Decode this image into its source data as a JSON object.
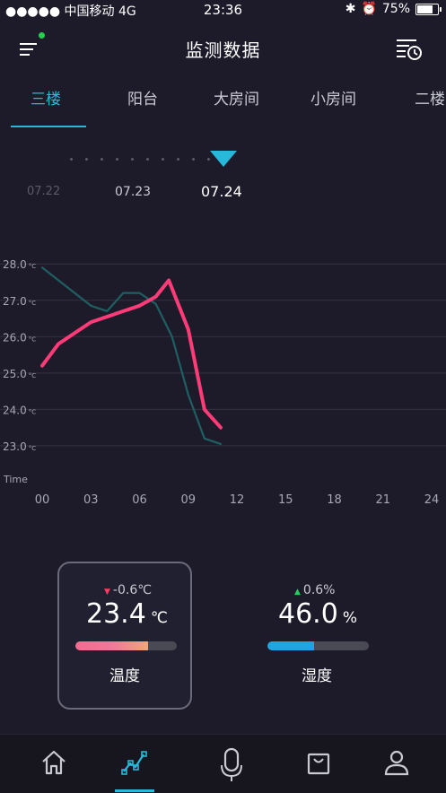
{
  "status_bar": {
    "carrier": "●●●●● 中国移动 4G",
    "time": "23:36",
    "battery": "75%"
  },
  "header": {
    "title": "监测数据"
  },
  "tabs": [
    "三楼",
    "阳台",
    "大房间",
    "小房间",
    "二楼"
  ],
  "dates": [
    "07.22",
    "07.23",
    "07.24"
  ],
  "chart_data": {
    "type": "line",
    "x": [
      0,
      3,
      6,
      9,
      12,
      15,
      18,
      21,
      24
    ],
    "x_tick_labels": [
      "00",
      "03",
      "06",
      "09",
      "12",
      "15",
      "18",
      "21",
      "24"
    ],
    "xlabel": "Time",
    "y_tick_values": [
      28.0,
      27.0,
      26.0,
      25.0,
      24.0,
      23.0
    ],
    "y_tick_labels": [
      "28.0",
      "27.0",
      "26.0",
      "25.0",
      "24.0",
      "23.0"
    ],
    "y_unit": "°C",
    "ylim": [
      22.8,
      28.4
    ],
    "xlim": [
      0,
      24
    ],
    "series": [
      {
        "color": "#ff3b78",
        "points": [
          [
            0,
            25.2
          ],
          [
            1,
            25.8
          ],
          [
            3,
            26.4
          ],
          [
            5,
            26.7
          ],
          [
            6,
            26.85
          ],
          [
            7,
            27.1
          ],
          [
            7.8,
            27.55
          ],
          [
            9,
            26.2
          ],
          [
            10,
            24.0
          ],
          [
            11,
            23.5
          ]
        ]
      },
      {
        "color": "#1f5f62",
        "points": [
          [
            0,
            27.9
          ],
          [
            2,
            27.2
          ],
          [
            3,
            26.85
          ],
          [
            4,
            26.7
          ],
          [
            5,
            27.2
          ],
          [
            6,
            27.2
          ],
          [
            7,
            26.9
          ],
          [
            8,
            26.0
          ],
          [
            9,
            24.4
          ],
          [
            10,
            23.2
          ],
          [
            11,
            23.05
          ]
        ]
      }
    ],
    "grid": true
  },
  "stats": {
    "temperature": {
      "delta": "-0.6℃",
      "value": "23.4",
      "unit": "℃",
      "label": "温度",
      "bar_fraction": 0.72,
      "bar_color": "#f0789a"
    },
    "humidity": {
      "delta": "0.6%",
      "value": "46.0",
      "unit": "%",
      "label": "湿度",
      "bar_fraction": 0.46,
      "bar_color": "#1fa6e0"
    }
  },
  "nav": {
    "items": [
      "home-icon",
      "trend-icon",
      "microphone-icon",
      "bag-icon",
      "user-icon"
    ],
    "active": "trend-icon"
  },
  "colors": {
    "accent": "#27b8da",
    "background": "#1d1b2a"
  }
}
